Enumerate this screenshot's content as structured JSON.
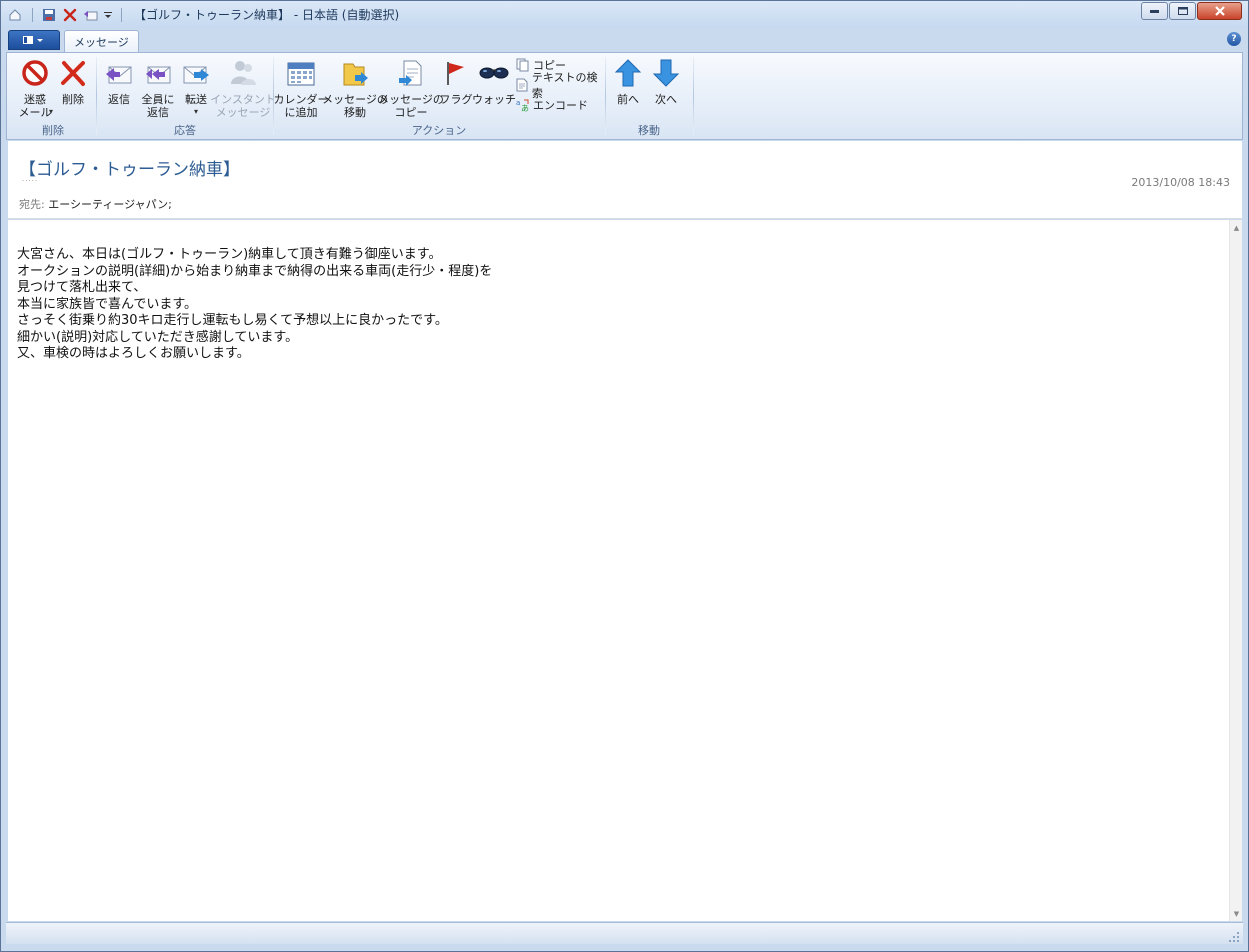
{
  "window": {
    "title": "【ゴルフ・トゥーラン納車】 - 日本語 (自動選択)"
  },
  "ribbon": {
    "tab": "メッセージ",
    "help": "?",
    "groups": {
      "delete": {
        "label": "削除",
        "junk": "迷惑\nメール",
        "delete": "削除"
      },
      "respond": {
        "label": "応答",
        "reply": "返信",
        "reply_all": "全員に\n返信",
        "forward": "転送",
        "instant_message": "インスタント\nメッセージ"
      },
      "actions": {
        "label": "アクション",
        "add_calendar": "カレンダー\nに追加",
        "move_message": "メッセージの\n移動",
        "copy_message": "メッセージの\nコピー",
        "flag": "フラグ",
        "watch": "ウォッチ",
        "copy": "コピー",
        "find_text": "テキストの検索",
        "encode": "エンコード"
      },
      "navigate": {
        "label": "移動",
        "previous": "前へ",
        "next": "次へ"
      }
    }
  },
  "message": {
    "subject": "【ゴルフ・トゥーラン納車】",
    "date": "2013/10/08 18:43",
    "to_label": "宛先:",
    "to_value": "エーシーティージャパン;",
    "body": [
      "大宮さん、本日は(ゴルフ・トゥーラン)納車して頂き有難う御座います。",
      "オークションの説明(詳細)から始まり納車まで納得の出来る車両(走行少・程度)を",
      "見つけて落札出来て、",
      "本当に家族皆で喜んでいます。",
      "さっそく街乗り約30キロ走行し運転もし易くて予想以上に良かったです。",
      "細かい(説明)対応していただき感謝しています。",
      "又、車検の時はよろしくお願いします。"
    ]
  },
  "colors": {
    "subject": "#2d5c93",
    "ribbon_bg": "#e3ecf8",
    "frame": "#c9d9ee"
  }
}
